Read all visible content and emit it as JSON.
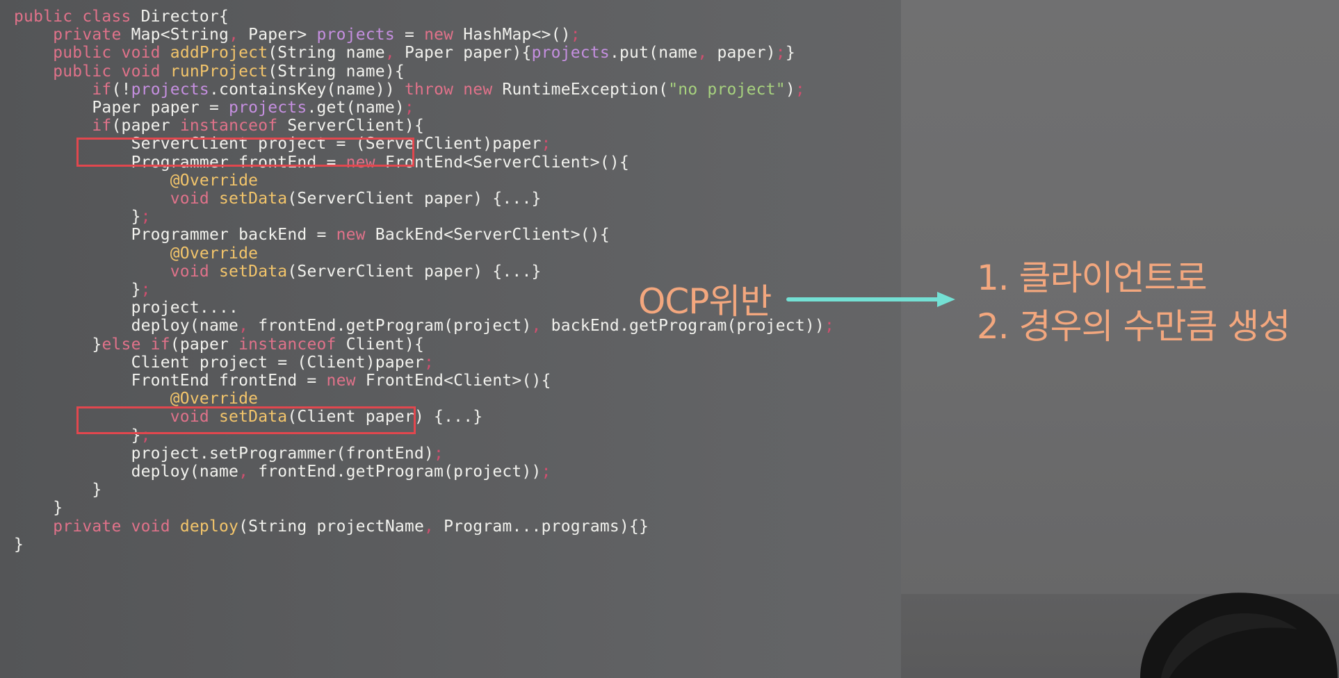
{
  "code": {
    "lines": [
      [
        [
          "kw",
          "public class "
        ],
        [
          "pl",
          "Director{"
        ]
      ],
      [
        [
          "kw",
          "    private "
        ],
        [
          "pl",
          "Map<String"
        ],
        [
          "pn",
          ", "
        ],
        [
          "pl",
          "Paper> "
        ],
        [
          "fld",
          "projects"
        ],
        [
          "pl",
          " = "
        ],
        [
          "kw",
          "new "
        ],
        [
          "pl",
          "HashMap<>()"
        ],
        [
          "pn",
          ";"
        ]
      ],
      [
        [
          "kw",
          "    public void "
        ],
        [
          "mth",
          "addProject"
        ],
        [
          "pl",
          "(String name"
        ],
        [
          "pn",
          ", "
        ],
        [
          "pl",
          "Paper paper){"
        ],
        [
          "fld",
          "projects"
        ],
        [
          "pl",
          ".put(name"
        ],
        [
          "pn",
          ", "
        ],
        [
          "pl",
          "paper)"
        ],
        [
          "pn",
          ";"
        ],
        [
          "pl",
          "}"
        ]
      ],
      [
        [
          "kw",
          "    public void "
        ],
        [
          "mth",
          "runProject"
        ],
        [
          "pl",
          "(String name){"
        ]
      ],
      [
        [
          "kw",
          "        if"
        ],
        [
          "pl",
          "(!"
        ],
        [
          "fld",
          "projects"
        ],
        [
          "pl",
          ".containsKey(name)) "
        ],
        [
          "kw",
          "throw new "
        ],
        [
          "pl",
          "RuntimeException("
        ],
        [
          "str",
          "\"no project\""
        ],
        [
          "pl",
          ")"
        ],
        [
          "pn",
          ";"
        ]
      ],
      [
        [
          "pl",
          "        Paper paper = "
        ],
        [
          "fld",
          "projects"
        ],
        [
          "pl",
          ".get(name)"
        ],
        [
          "pn",
          ";"
        ]
      ],
      [
        [
          "kw",
          "        if"
        ],
        [
          "pl",
          "(paper "
        ],
        [
          "kw",
          "instanceof "
        ],
        [
          "pl",
          "ServerClient){"
        ]
      ],
      [
        [
          "pl",
          "            ServerClient project = (ServerClient)paper"
        ],
        [
          "pn",
          ";"
        ]
      ],
      [
        [
          "pl",
          "            Programmer frontEnd = "
        ],
        [
          "kw",
          "new "
        ],
        [
          "pl",
          "FrontEnd<ServerClient>(){"
        ]
      ],
      [
        [
          "ann",
          "                @Override"
        ]
      ],
      [
        [
          "kw",
          "                void "
        ],
        [
          "mth",
          "setData"
        ],
        [
          "pl",
          "(ServerClient paper) {...}"
        ]
      ],
      [
        [
          "pl",
          "            }"
        ],
        [
          "pn",
          ";"
        ]
      ],
      [
        [
          "pl",
          "            Programmer backEnd = "
        ],
        [
          "kw",
          "new "
        ],
        [
          "pl",
          "BackEnd<ServerClient>(){"
        ]
      ],
      [
        [
          "ann",
          "                @Override"
        ]
      ],
      [
        [
          "kw",
          "                void "
        ],
        [
          "mth",
          "setData"
        ],
        [
          "pl",
          "(ServerClient paper) {...}"
        ]
      ],
      [
        [
          "pl",
          "            }"
        ],
        [
          "pn",
          ";"
        ]
      ],
      [
        [
          "pl",
          "            project...."
        ]
      ],
      [
        [
          "pl",
          "            deploy(name"
        ],
        [
          "pn",
          ", "
        ],
        [
          "pl",
          "frontEnd.getProgram(project)"
        ],
        [
          "pn",
          ", "
        ],
        [
          "pl",
          "backEnd.getProgram(project))"
        ],
        [
          "pn",
          ";"
        ]
      ],
      [
        [
          "pl",
          "        }"
        ],
        [
          "kw",
          "else if"
        ],
        [
          "pl",
          "(paper "
        ],
        [
          "kw",
          "instanceof "
        ],
        [
          "pl",
          "Client){"
        ]
      ],
      [
        [
          "pl",
          "            Client project = (Client)paper"
        ],
        [
          "pn",
          ";"
        ]
      ],
      [
        [
          "pl",
          "            FrontEnd frontEnd = "
        ],
        [
          "kw",
          "new "
        ],
        [
          "pl",
          "FrontEnd<Client>(){"
        ]
      ],
      [
        [
          "ann",
          "                @Override"
        ]
      ],
      [
        [
          "kw",
          "                void "
        ],
        [
          "mth",
          "setData"
        ],
        [
          "pl",
          "(Client paper) {...}"
        ]
      ],
      [
        [
          "pl",
          "            }"
        ],
        [
          "pn",
          ";"
        ]
      ],
      [
        [
          "pl",
          "            project.setProgrammer(frontEnd)"
        ],
        [
          "pn",
          ";"
        ]
      ],
      [
        [
          "pl",
          "            deploy(name"
        ],
        [
          "pn",
          ", "
        ],
        [
          "pl",
          "frontEnd.getProgram(project))"
        ],
        [
          "pn",
          ";"
        ]
      ],
      [
        [
          "pl",
          "        }"
        ]
      ],
      [
        [
          "pl",
          "    }"
        ]
      ],
      [
        [
          "kw",
          "    private void "
        ],
        [
          "mth",
          "deploy"
        ],
        [
          "pl",
          "(String projectName"
        ],
        [
          "pn",
          ", "
        ],
        [
          "pl",
          "Program...programs){}"
        ]
      ],
      [
        [
          "pl",
          "}"
        ]
      ]
    ]
  },
  "annotation": {
    "label": "OCP위반",
    "notes": [
      "1. 클라이언트로",
      "2. 경우의 수만큼 생성"
    ]
  },
  "colors": {
    "keyword": "#e0728a",
    "field": "#c58fe0",
    "method": "#f3c56b",
    "string": "#a7d27e",
    "highlight_box": "#e2474e",
    "annotation_text": "#f3a77e",
    "arrow": "#74e0d4"
  }
}
